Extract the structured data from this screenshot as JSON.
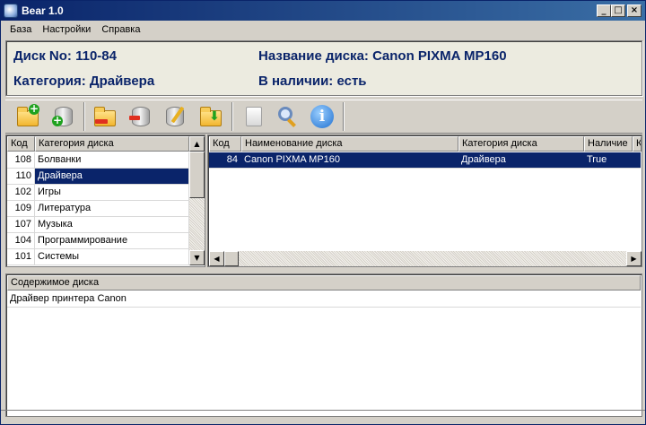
{
  "window": {
    "title": "Bear 1.0",
    "min": "_",
    "max": "□",
    "close": "×"
  },
  "menu": [
    "База",
    "Настройки",
    "Справка"
  ],
  "info": {
    "disk_no": "Диск No: 110-84",
    "disk_name": "Название диска: Canon PIXMA MP160",
    "category": "Категория: Драйвера",
    "availability": "В наличии: есть"
  },
  "toolbar": {
    "items": [
      "new-folder-icon",
      "add-disk-icon",
      "open-folder-icon",
      "remove-disk-icon",
      "edit-disk-icon",
      "import-folder-icon",
      "blank-icon",
      "search-icon",
      "info-icon"
    ],
    "info_glyph": "i"
  },
  "categories": {
    "headers": [
      "Код",
      "Категория диска"
    ],
    "rows": [
      {
        "code": "108",
        "name": "Болванки"
      },
      {
        "code": "110",
        "name": "Драйвера"
      },
      {
        "code": "102",
        "name": "Игры"
      },
      {
        "code": "109",
        "name": "Литература"
      },
      {
        "code": "107",
        "name": "Музыка"
      },
      {
        "code": "104",
        "name": "Программирование"
      },
      {
        "code": "101",
        "name": "Системы"
      }
    ],
    "selected_index": 1
  },
  "disks": {
    "headers": [
      "Код",
      "Наименование диска",
      "Категория диска",
      "Наличие",
      "К"
    ],
    "rows": [
      {
        "code": "84",
        "name": "Canon PIXMA MP160",
        "category": "Драйвера",
        "available": "True"
      }
    ]
  },
  "contents": {
    "header": "Содержимое диска",
    "text": "Драйвер принтера Canon"
  },
  "scroll": {
    "up": "▲",
    "down": "▼",
    "left": "◀",
    "right": "▶"
  }
}
